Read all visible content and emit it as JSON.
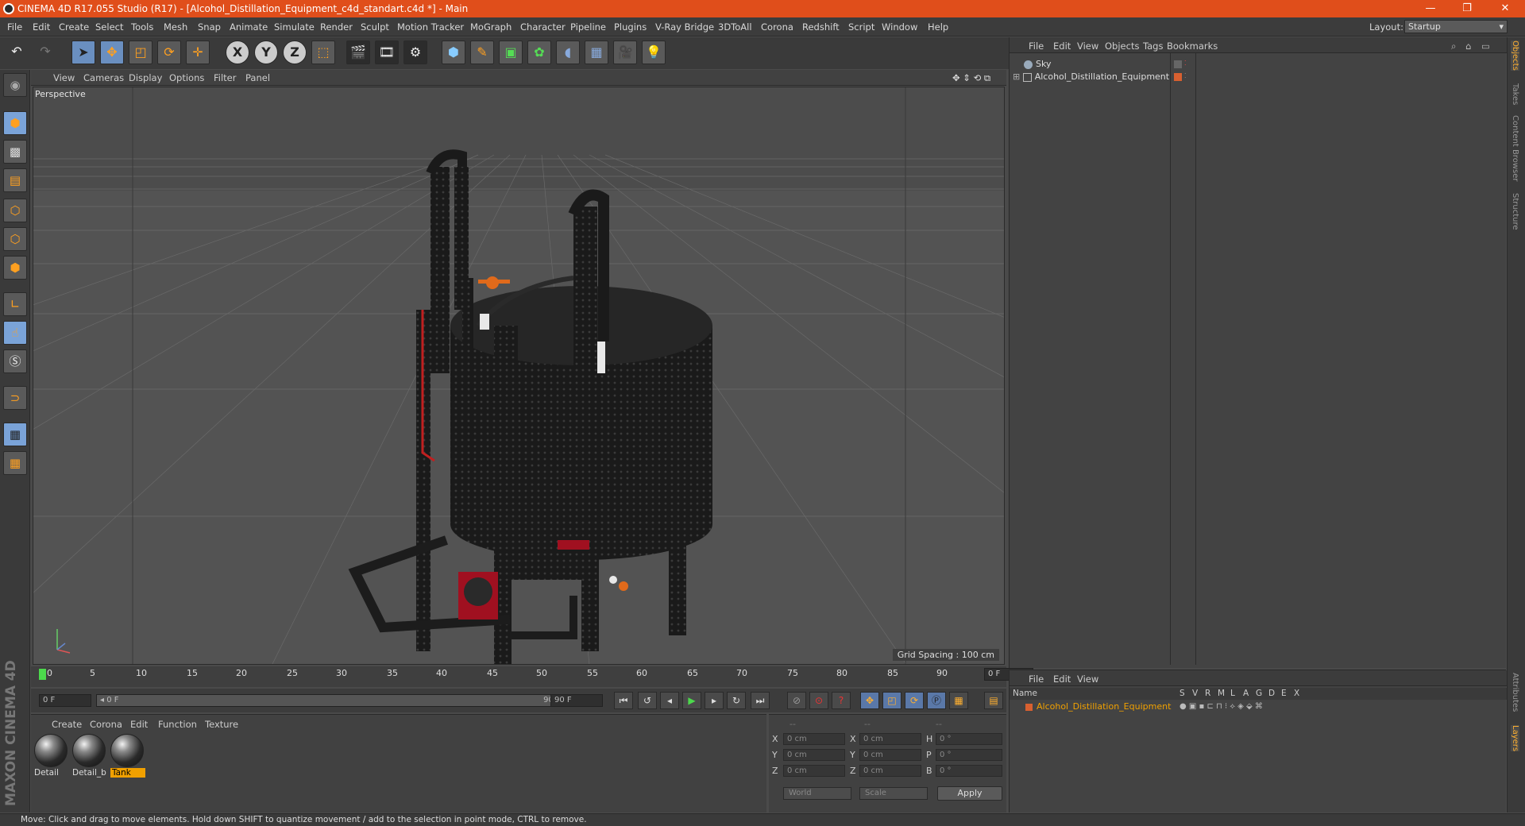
{
  "window": {
    "title": "CINEMA 4D R17.055 Studio (R17) - [Alcohol_Distillation_Equipment_c4d_standart.c4d *] - Main",
    "minimize": "—",
    "restore": "❐",
    "close": "✕"
  },
  "menu": [
    "File",
    "Edit",
    "Create",
    "Select",
    "Tools",
    "Mesh",
    "Snap",
    "Animate",
    "Simulate",
    "Render",
    "Sculpt",
    "Motion Tracker",
    "MoGraph",
    "Character",
    "Pipeline",
    "Plugins",
    "V-Ray Bridge",
    "3DToAll",
    "Corona",
    "Redshift",
    "Script",
    "Window",
    "Help"
  ],
  "layout": {
    "label": "Layout:",
    "value": "Startup"
  },
  "toolbar": {
    "axis_x": "X",
    "axis_y": "Y",
    "axis_z": "Z"
  },
  "viewport": {
    "menu": [
      "View",
      "Cameras",
      "Display",
      "Options",
      "Filter",
      "Panel"
    ],
    "label": "Perspective",
    "grid_spacing": "Grid Spacing : 100 cm"
  },
  "timeline": {
    "ticks": [
      "0",
      "5",
      "10",
      "15",
      "20",
      "25",
      "30",
      "35",
      "40",
      "45",
      "50",
      "55",
      "60",
      "65",
      "70",
      "75",
      "80",
      "85",
      "90"
    ],
    "current_frame": "0 F"
  },
  "playback": {
    "start": "0 F",
    "range_start": "◂ 0 F",
    "range_end": "90 F ▸",
    "end": "90 F"
  },
  "materials": {
    "menu": [
      "Create",
      "Corona",
      "Edit",
      "Function",
      "Texture"
    ],
    "items": [
      {
        "name": "Detail",
        "selected": false
      },
      {
        "name": "Detail_b",
        "selected": false
      },
      {
        "name": "Tank",
        "selected": true
      }
    ]
  },
  "coords": {
    "headers": [
      "--",
      "--",
      "--"
    ],
    "rows": [
      {
        "a": "X",
        "av": "0 cm",
        "b": "X",
        "bv": "0 cm",
        "c": "H",
        "cv": "0 °"
      },
      {
        "a": "Y",
        "av": "0 cm",
        "b": "Y",
        "bv": "0 cm",
        "c": "P",
        "cv": "0 °"
      },
      {
        "a": "Z",
        "av": "0 cm",
        "b": "Z",
        "bv": "0 cm",
        "c": "B",
        "cv": "0 °"
      }
    ],
    "world": "World",
    "scale": "Scale",
    "apply": "Apply"
  },
  "objects": {
    "menu": [
      "File",
      "Edit",
      "View",
      "Objects",
      "Tags",
      "Bookmarks"
    ],
    "items": [
      "Sky",
      "Alcohol_Distillation_Equipment"
    ]
  },
  "layers": {
    "menu": [
      "File",
      "Edit",
      "View"
    ],
    "columns": [
      "Name",
      "S",
      "V",
      "R",
      "M",
      "L",
      "A",
      "G",
      "D",
      "E",
      "X"
    ],
    "row": "Alcohol_Distillation_Equipment"
  },
  "right_tabs": [
    "Objects",
    "Takes",
    "Content Browser",
    "Structure",
    "Attributes",
    "Layers"
  ],
  "brand": "MAXON CINEMA 4D",
  "status": "Move: Click and drag to move elements. Hold down SHIFT to quantize movement / add to the selection in point mode, CTRL to remove.",
  "colors": {
    "title_bar": "#e04e1b",
    "accent": "#f0a000",
    "playhead": "#4cd94c"
  }
}
